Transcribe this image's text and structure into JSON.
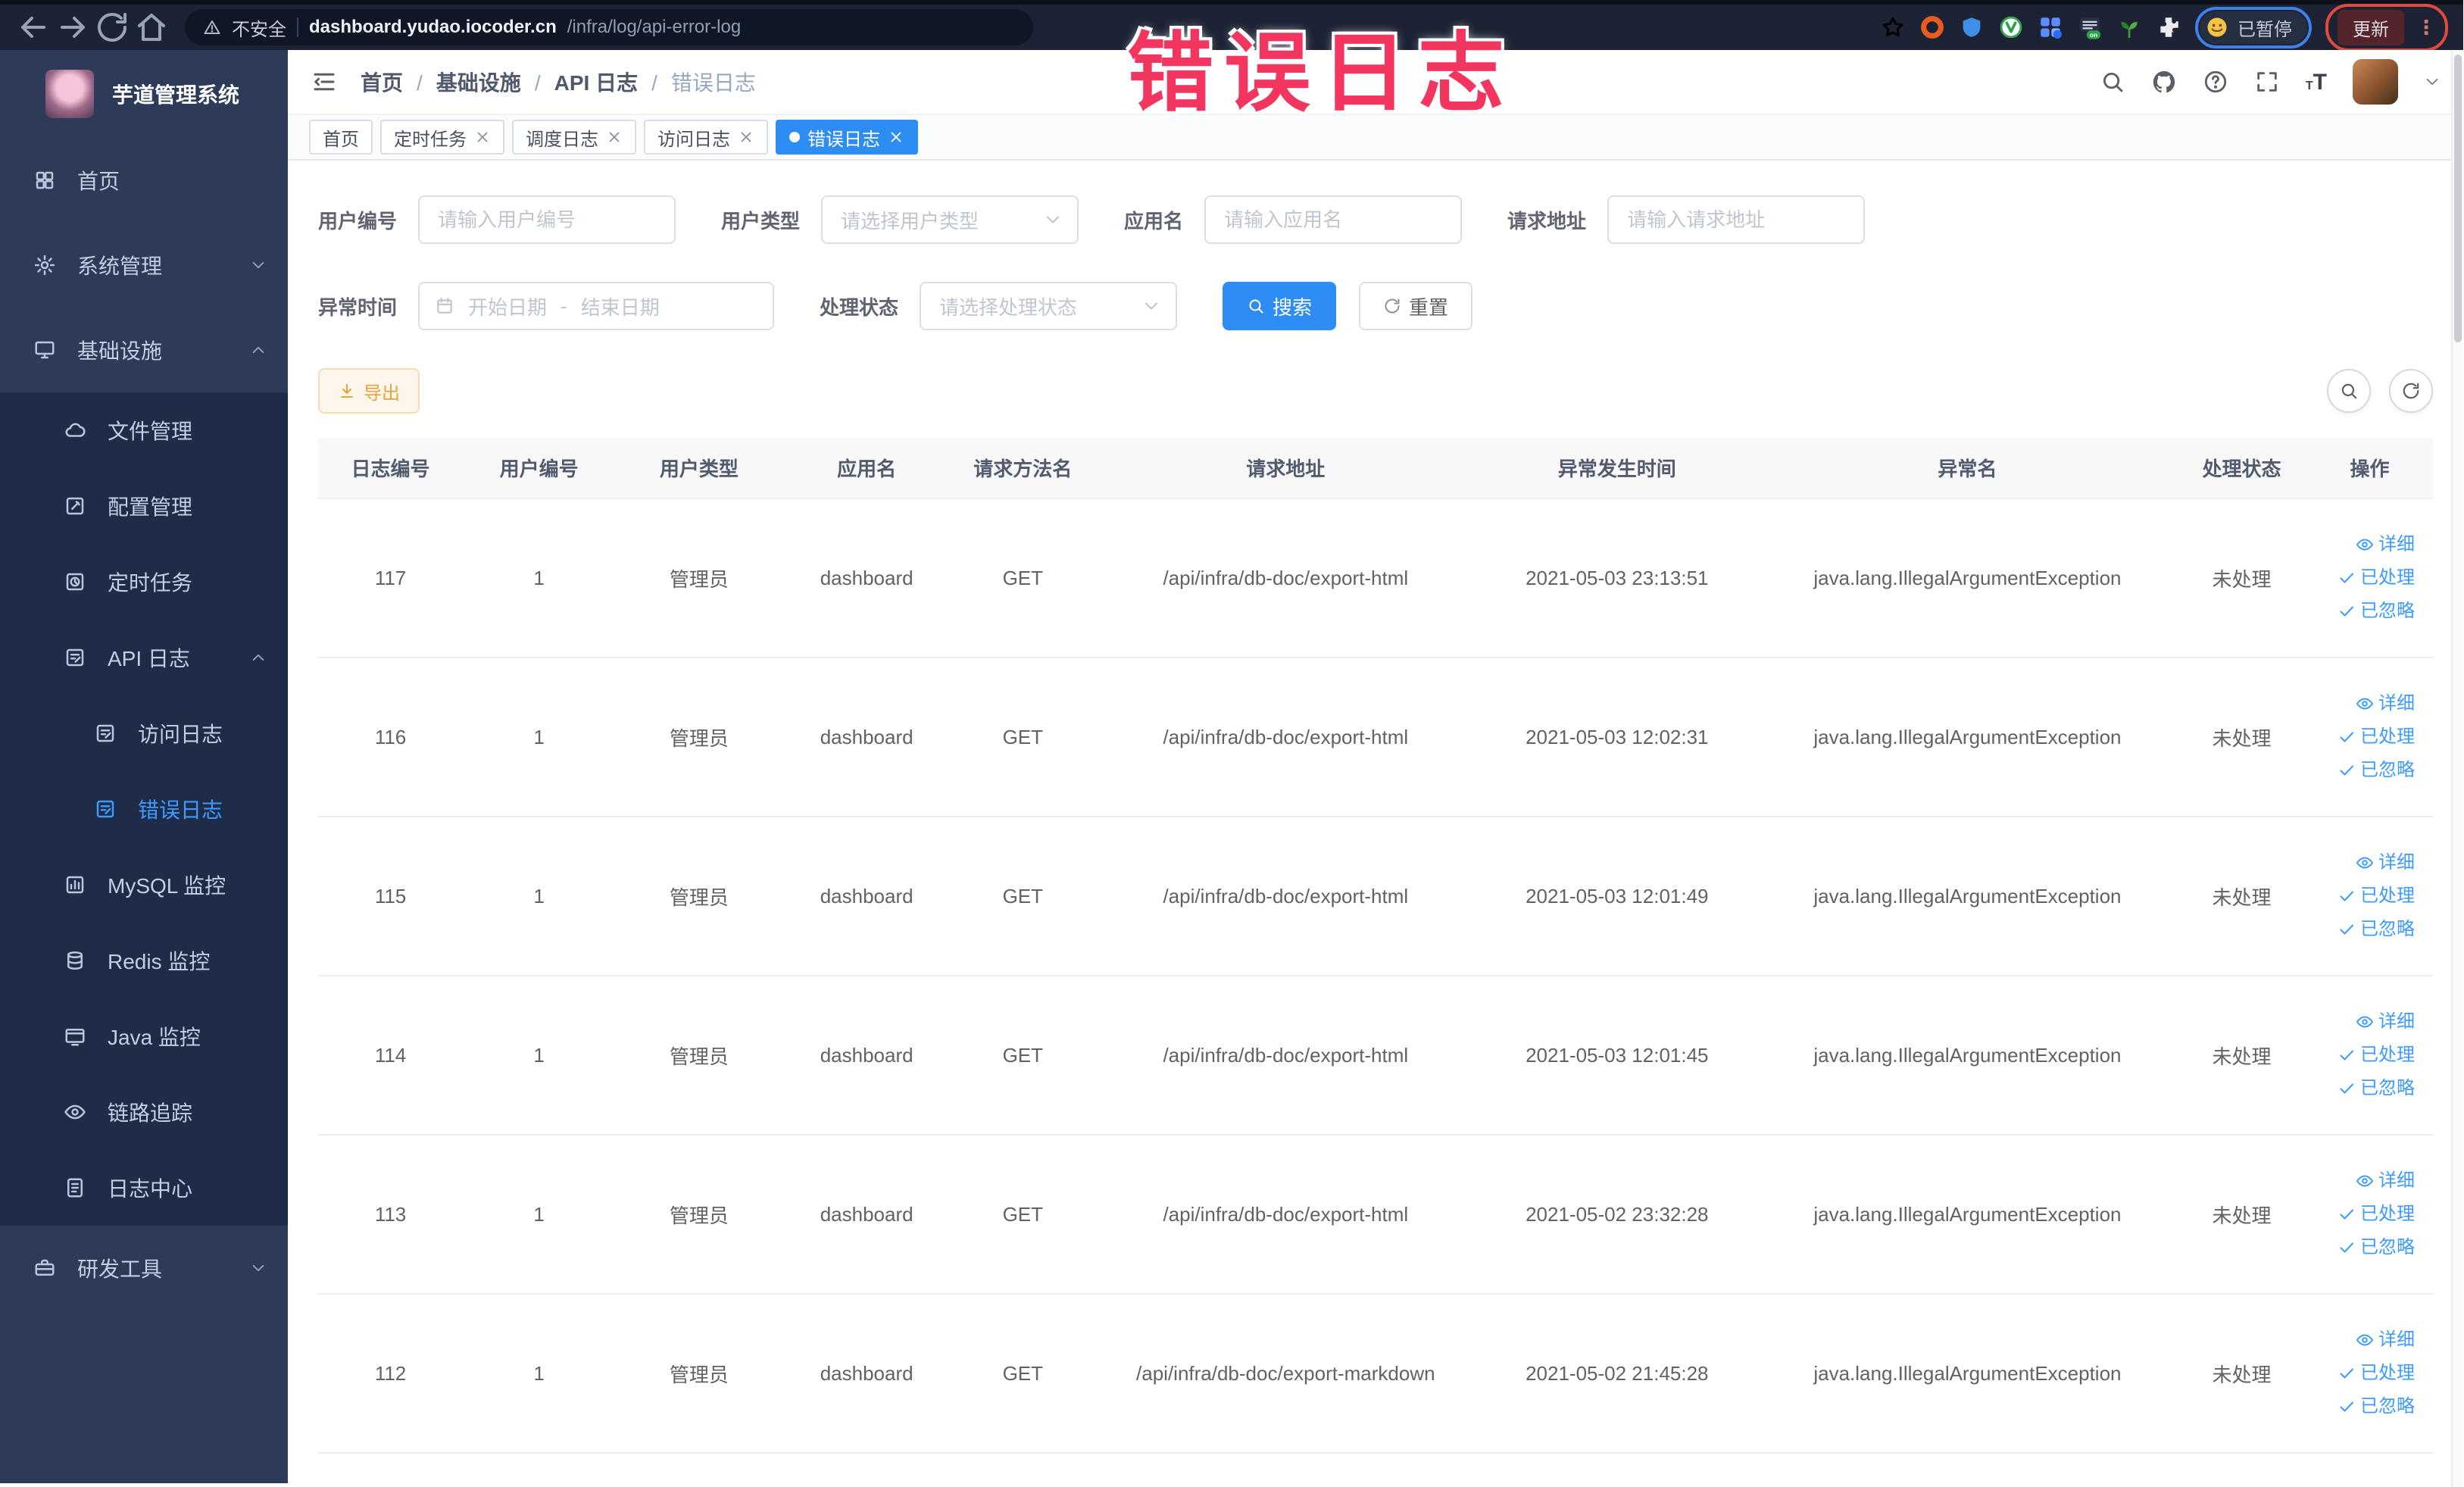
{
  "browser": {
    "security_label": "不安全",
    "url_domain": "dashboard.yudao.iocoder.cn",
    "url_path": "/infra/log/api-error-log",
    "paused_label": "已暂停",
    "update_label": "更新",
    "extension_badge": "on"
  },
  "annotation": {
    "title": "错误日志",
    "color": "#f3365f"
  },
  "sidebar": {
    "app_title": "芋道管理系统",
    "menu": [
      {
        "name": "home",
        "label": "首页",
        "icon": "home-icon",
        "level": 0
      },
      {
        "name": "system-management",
        "label": "系统管理",
        "icon": "gear-icon",
        "level": 0,
        "arrow": "down"
      },
      {
        "name": "infrastructure",
        "label": "基础设施",
        "icon": "monitor-icon",
        "level": 0,
        "arrow": "up"
      },
      {
        "name": "file-management",
        "label": "文件管理",
        "icon": "cloud-icon",
        "level": 1,
        "sub": true
      },
      {
        "name": "config-management",
        "label": "配置管理",
        "icon": "edit-square-icon",
        "level": 1,
        "sub": true
      },
      {
        "name": "scheduled-tasks",
        "label": "定时任务",
        "icon": "timer-icon",
        "level": 1,
        "sub": true
      },
      {
        "name": "api-logs",
        "label": "API 日志",
        "icon": "doc-edit-icon",
        "level": 1,
        "sub": true,
        "arrow": "up"
      },
      {
        "name": "access-logs",
        "label": "访问日志",
        "icon": "doc-edit-icon",
        "level": 2,
        "sub": true
      },
      {
        "name": "error-logs",
        "label": "错误日志",
        "icon": "doc-edit-icon",
        "level": 2,
        "sub": true,
        "active": true
      },
      {
        "name": "mysql-monitor",
        "label": "MySQL 监控",
        "icon": "chart-icon",
        "level": 1,
        "sub": true
      },
      {
        "name": "redis-monitor",
        "label": "Redis 监控",
        "icon": "database-icon",
        "level": 1,
        "sub": true
      },
      {
        "name": "java-monitor",
        "label": "Java 监控",
        "icon": "window-icon",
        "level": 1,
        "sub": true
      },
      {
        "name": "tracing",
        "label": "链路追踪",
        "icon": "eye-icon",
        "level": 1,
        "sub": true
      },
      {
        "name": "log-center",
        "label": "日志中心",
        "icon": "doc-lines-icon",
        "level": 1,
        "sub": true
      },
      {
        "name": "dev-tools",
        "label": "研发工具",
        "icon": "toolbox-icon",
        "level": 0,
        "arrow": "down"
      }
    ]
  },
  "navbar": {
    "breadcrumb": [
      "首页",
      "基础设施",
      "API 日志",
      "错误日志"
    ]
  },
  "tags": [
    {
      "name": "home",
      "label": "首页"
    },
    {
      "name": "scheduled-tasks",
      "label": "定时任务",
      "closable": true
    },
    {
      "name": "schedule-logs",
      "label": "调度日志",
      "closable": true
    },
    {
      "name": "access-logs",
      "label": "访问日志",
      "closable": true
    },
    {
      "name": "error-logs",
      "label": "错误日志",
      "closable": true,
      "active": true
    }
  ],
  "filters": {
    "user_id": {
      "label": "用户编号",
      "placeholder": "请输入用户编号"
    },
    "user_type": {
      "label": "用户类型",
      "placeholder": "请选择用户类型"
    },
    "app_name": {
      "label": "应用名",
      "placeholder": "请输入应用名"
    },
    "request_url": {
      "label": "请求地址",
      "placeholder": "请输入请求地址"
    },
    "exception_time": {
      "label": "异常时间",
      "start_placeholder": "开始日期",
      "separator": "-",
      "end_placeholder": "结束日期"
    },
    "process_status": {
      "label": "处理状态",
      "placeholder": "请选择处理状态"
    },
    "search_label": "搜索",
    "reset_label": "重置"
  },
  "toolbar": {
    "export_label": "导出"
  },
  "table": {
    "columns": [
      "日志编号",
      "用户编号",
      "用户类型",
      "应用名",
      "请求方法名",
      "请求地址",
      "异常发生时间",
      "异常名",
      "处理状态",
      "操作"
    ],
    "action_labels": [
      "详细",
      "已处理",
      "已忽略"
    ],
    "rows": [
      {
        "log_id": "117",
        "user_id": "1",
        "user_type": "管理员",
        "app_name": "dashboard",
        "method": "GET",
        "url": "/api/infra/db-doc/export-html",
        "time": "2021-05-03 23:13:51",
        "exception": "java.lang.IllegalArgumentException",
        "status": "未处理"
      },
      {
        "log_id": "116",
        "user_id": "1",
        "user_type": "管理员",
        "app_name": "dashboard",
        "method": "GET",
        "url": "/api/infra/db-doc/export-html",
        "time": "2021-05-03 12:02:31",
        "exception": "java.lang.IllegalArgumentException",
        "status": "未处理"
      },
      {
        "log_id": "115",
        "user_id": "1",
        "user_type": "管理员",
        "app_name": "dashboard",
        "method": "GET",
        "url": "/api/infra/db-doc/export-html",
        "time": "2021-05-03 12:01:49",
        "exception": "java.lang.IllegalArgumentException",
        "status": "未处理"
      },
      {
        "log_id": "114",
        "user_id": "1",
        "user_type": "管理员",
        "app_name": "dashboard",
        "method": "GET",
        "url": "/api/infra/db-doc/export-html",
        "time": "2021-05-03 12:01:45",
        "exception": "java.lang.IllegalArgumentException",
        "status": "未处理"
      },
      {
        "log_id": "113",
        "user_id": "1",
        "user_type": "管理员",
        "app_name": "dashboard",
        "method": "GET",
        "url": "/api/infra/db-doc/export-html",
        "time": "2021-05-02 23:32:28",
        "exception": "java.lang.IllegalArgumentException",
        "status": "未处理"
      },
      {
        "log_id": "112",
        "user_id": "1",
        "user_type": "管理员",
        "app_name": "dashboard",
        "method": "GET",
        "url": "/api/infra/db-doc/export-markdown",
        "time": "2021-05-02 21:45:28",
        "exception": "java.lang.IllegalArgumentException",
        "status": "未处理"
      }
    ]
  },
  "colors": {
    "primary": "#2e8df2",
    "link": "#3d9bff",
    "warning": "#e6a23c",
    "annotation": "#f3365f"
  }
}
